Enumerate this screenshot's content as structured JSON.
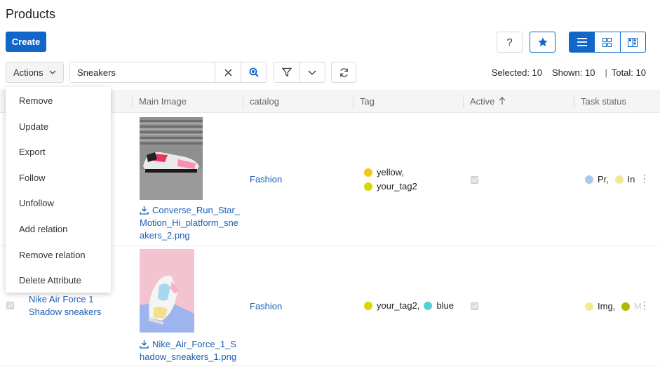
{
  "header": {
    "title": "Products",
    "create_label": "Create",
    "help_label": "?"
  },
  "toolbar": {
    "actions_label": "Actions",
    "search": {
      "value": "Sneakers",
      "placeholder": ""
    },
    "counts": {
      "selected": "Selected: 10",
      "shown": "Shown: 10",
      "separator": "|",
      "total": "Total: 10"
    }
  },
  "actions_menu": [
    "Remove",
    "Update",
    "Export",
    "Follow",
    "Unfollow",
    "Add relation",
    "Remove relation",
    "Delete Attribute"
  ],
  "table": {
    "columns": [
      "Main Image",
      "catalog",
      "Tag",
      "Active",
      "Task status"
    ],
    "rows": [
      {
        "name": "",
        "image_file": "Converse_Run_Star_Motion_Hi_platform_sneakers_2.png",
        "catalog": "Fashion",
        "tags": [
          {
            "label": "yellow,",
            "color": "#f5c518"
          },
          {
            "label": "your_tag2",
            "color": "#d8d800"
          }
        ],
        "active": true,
        "task_status": [
          {
            "label": "Pr,",
            "color": "#a9c8ee"
          },
          {
            "label": "In",
            "color": "#ecec90"
          }
        ]
      },
      {
        "name": "Nike Air Force 1 Shadow sneakers",
        "image_file": "Nike_Air_Force_1_Shadow_sneakers_1.png",
        "catalog": "Fashion",
        "tags": [
          {
            "label": "your_tag2,",
            "color": "#d8d800"
          },
          {
            "label": "blue",
            "color": "#55d0d0"
          }
        ],
        "active": true,
        "task_status": [
          {
            "label": "Img,",
            "color": "#ecec90"
          },
          {
            "label": "M",
            "color": "#b5b500"
          }
        ]
      }
    ]
  },
  "colors": {
    "accent": "#1167c8",
    "link": "#1a5fb4"
  }
}
